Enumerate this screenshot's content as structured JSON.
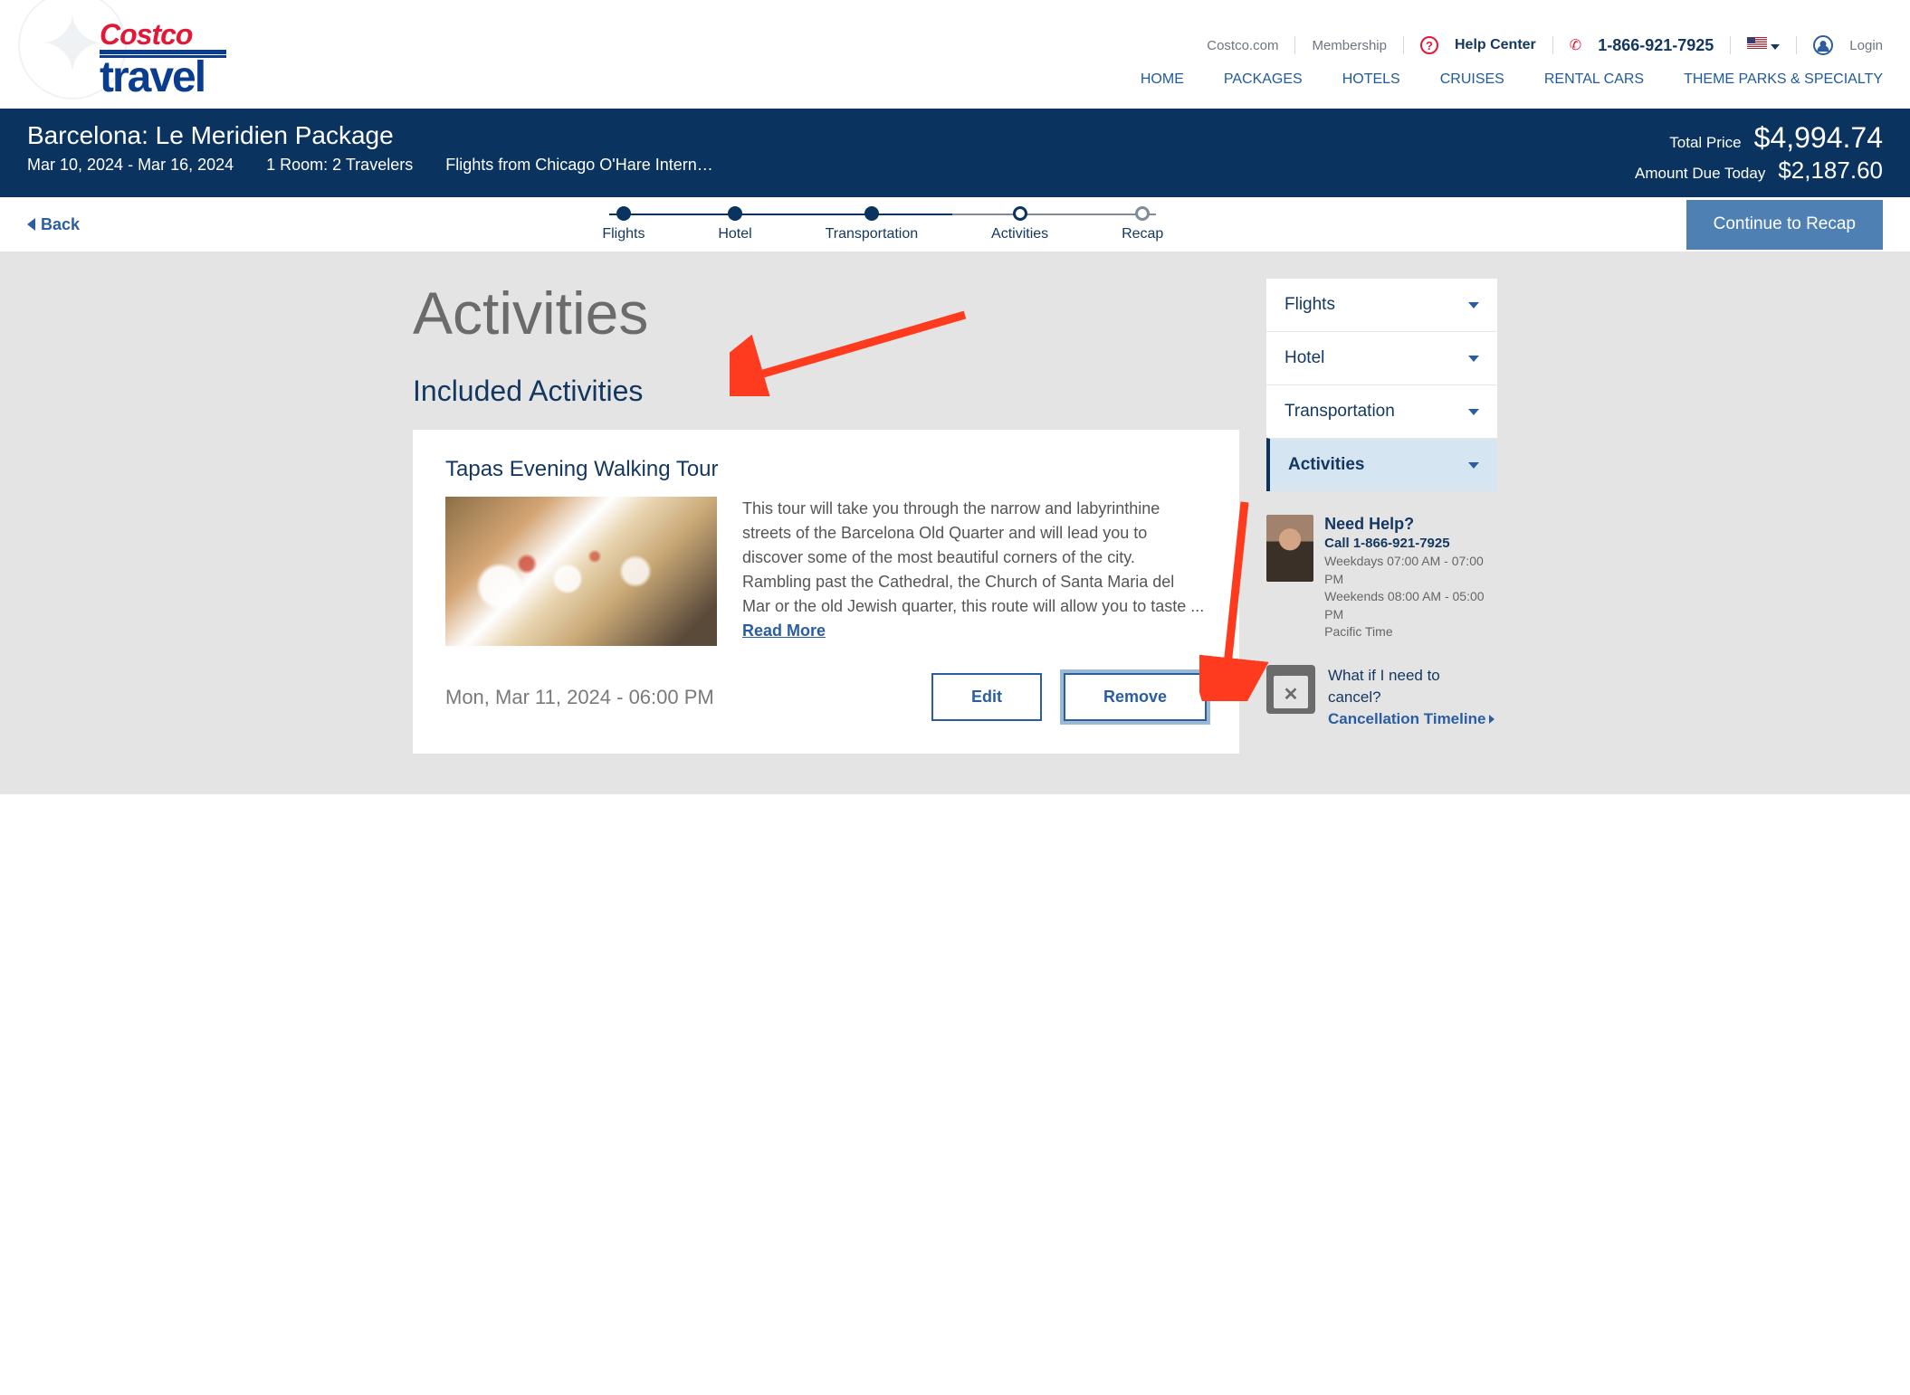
{
  "toplinks": {
    "costco": "Costco.com",
    "membership": "Membership",
    "help_center": "Help Center",
    "phone": "1-866-921-7925",
    "login": "Login"
  },
  "nav": [
    "HOME",
    "PACKAGES",
    "HOTELS",
    "CRUISES",
    "RENTAL CARS",
    "THEME PARKS & SPECIALTY"
  ],
  "summary": {
    "title": "Barcelona: Le Meridien Package",
    "dates": "Mar 10, 2024 - Mar 16, 2024",
    "rooms": "1 Room: 2 Travelers",
    "flights": "Flights from Chicago O'Hare Intern…",
    "total_label": "Total Price",
    "total": "$4,994.74",
    "due_label": "Amount Due Today",
    "due": "$2,187.60"
  },
  "stepper": {
    "back": "Back",
    "steps": [
      "Flights",
      "Hotel",
      "Transportation",
      "Activities",
      "Recap"
    ],
    "continue": "Continue to Recap"
  },
  "page": {
    "h1": "Activities",
    "h2": "Included Activities"
  },
  "activity": {
    "title": "Tapas Evening Walking Tour",
    "desc": "This tour will take you through the narrow and labyrinthine streets of the Barcelona Old Quarter and will lead you to discover some of the most beautiful corners of the city. Rambling past the Cathedral, the Church of Santa Maria del Mar or the old Jewish quarter, this route will allow you to taste ... ",
    "read_more": "Read More",
    "date": "Mon, Mar 11, 2024 - 06:00 PM",
    "edit": "Edit",
    "remove": "Remove"
  },
  "sidebar": {
    "items": [
      "Flights",
      "Hotel",
      "Transportation",
      "Activities"
    ]
  },
  "help": {
    "title": "Need Help?",
    "call": "Call 1-866-921-7925",
    "line1": "Weekdays 07:00 AM - 07:00 PM",
    "line2": "Weekends 08:00 AM - 05:00 PM",
    "line3": "Pacific Time"
  },
  "cancel": {
    "q": "What if I need to cancel?",
    "link": "Cancellation Timeline"
  }
}
